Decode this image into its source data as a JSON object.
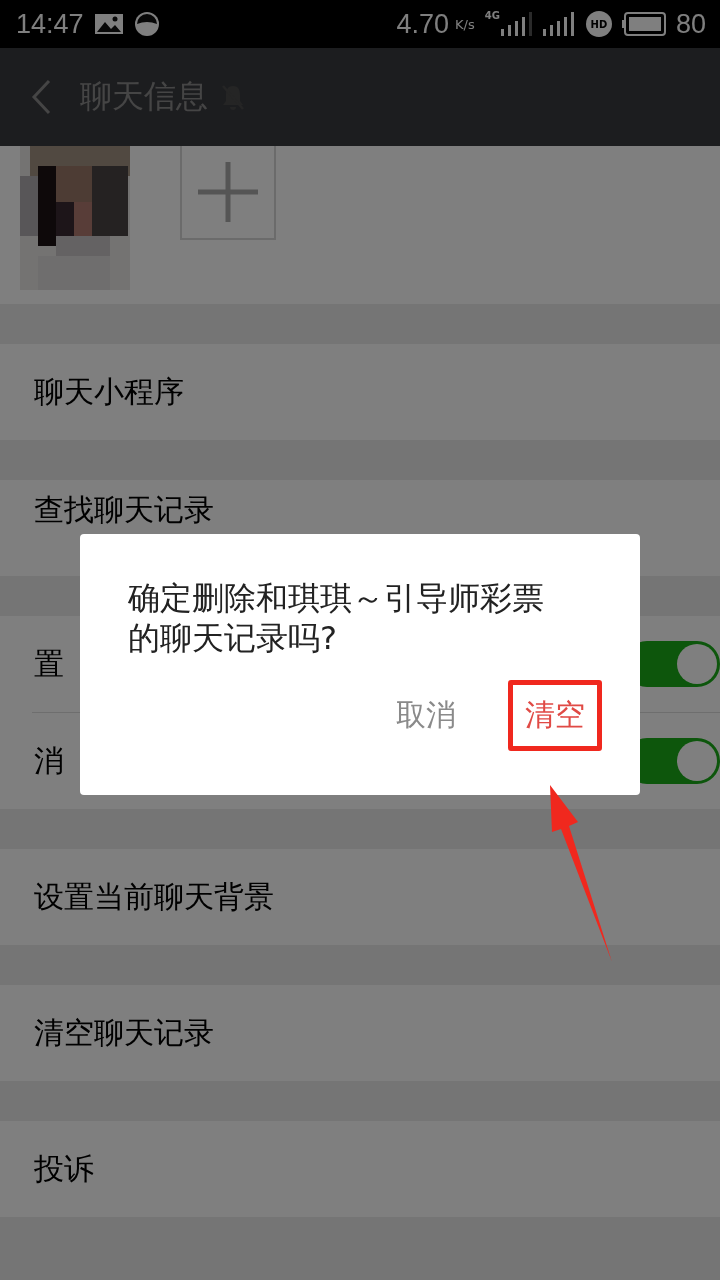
{
  "status_bar": {
    "time": "14:47",
    "speed": "4.70",
    "speed_unit": "K/s",
    "network": "4G",
    "hd": "HD",
    "battery": "80"
  },
  "header": {
    "title": "聊天信息",
    "muted": true
  },
  "members": {
    "add": true
  },
  "sections": [
    {
      "items": [
        {
          "kind": "link",
          "label": "聊天小程序"
        }
      ]
    },
    {
      "items": [
        {
          "kind": "link",
          "label": "查找聊天记录"
        }
      ]
    },
    {
      "items": [
        {
          "kind": "toggle",
          "label": "置",
          "on": true
        },
        {
          "kind": "toggle",
          "label": "消",
          "on": true
        }
      ]
    },
    {
      "items": [
        {
          "kind": "link",
          "label": "设置当前聊天背景"
        }
      ]
    },
    {
      "items": [
        {
          "kind": "link",
          "label": "清空聊天记录"
        }
      ]
    },
    {
      "items": [
        {
          "kind": "link",
          "label": "投诉"
        }
      ]
    }
  ],
  "dialog": {
    "message": "确定删除和琪琪～引导师彩票的聊天记录吗?",
    "buttons": [
      {
        "label": "取消",
        "kind": "cancel",
        "highlighted": false
      },
      {
        "label": "清空",
        "kind": "confirm",
        "highlighted": true
      }
    ]
  }
}
